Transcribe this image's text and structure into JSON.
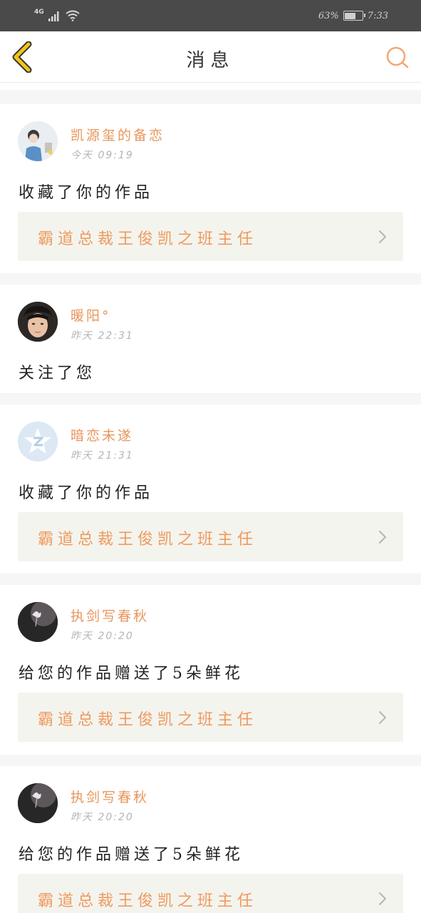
{
  "status_bar": {
    "network": "4G",
    "battery": "63%",
    "battery_level": 0.63,
    "time": "7:33"
  },
  "header": {
    "title": "消息"
  },
  "messages": [
    {
      "user": "凯源玺的备恋",
      "time": "今天 09:19",
      "action": "收藏了你的作品",
      "work_title": "霸道总裁王俊凯之班主任",
      "avatar_icon": "boy-in-room-avatar"
    },
    {
      "user": "暖阳°",
      "time": "昨天 22:31",
      "action": "关注了您",
      "avatar_icon": "face-selfie-avatar"
    },
    {
      "user": "暗恋未遂",
      "time": "昨天 21:31",
      "action": "收藏了你的作品",
      "work_title": "霸道总裁王俊凯之班主任",
      "avatar_icon": "default-z-avatar"
    },
    {
      "user": "执剑写春秋",
      "time": "昨天 20:20",
      "action": "给您的作品赠送了5朵鲜花",
      "work_title": "霸道总裁王俊凯之班主任",
      "avatar_icon": "dark-flower-avatar"
    },
    {
      "user": "执剑写春秋",
      "time": "昨天 20:20",
      "action": "给您的作品赠送了5朵鲜花",
      "work_title": "霸道总裁王俊凯之班主任",
      "avatar_icon": "dark-flower-avatar"
    }
  ],
  "colors": {
    "accent": "#e8955a",
    "status_bar": "#4a4a4a",
    "work_card_bg": "#f4f4ee",
    "back_icon": "#f0c419"
  }
}
